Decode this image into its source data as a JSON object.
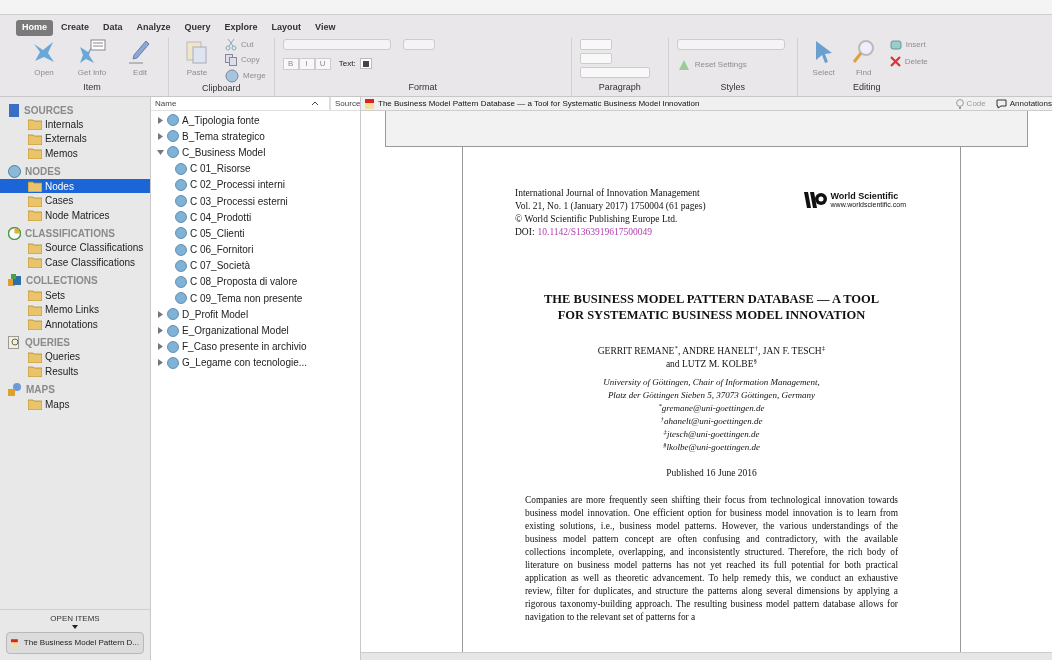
{
  "ribbon": {
    "tabs": [
      {
        "label": "Home",
        "selected": true
      },
      {
        "label": "Create",
        "selected": false
      },
      {
        "label": "Data",
        "selected": false
      },
      {
        "label": "Analyze",
        "selected": false
      },
      {
        "label": "Query",
        "selected": false
      },
      {
        "label": "Explore",
        "selected": false
      },
      {
        "label": "Layout",
        "selected": false
      },
      {
        "label": "View",
        "selected": false
      }
    ],
    "groups": [
      {
        "label": "Item",
        "tools": [
          {
            "kind": "open",
            "label": "Open",
            "disabled": true
          },
          {
            "kind": "info",
            "label": "Get Info",
            "disabled": true
          },
          {
            "kind": "edit",
            "label": "Edit",
            "disabled": true
          }
        ]
      },
      {
        "label": "Clipboard",
        "tools": [
          {
            "kind": "paste",
            "label": "Paste",
            "disabled": true
          },
          {
            "kind": "cut",
            "label": "Cut",
            "disabled": true
          },
          {
            "kind": "copy",
            "label": "Copy",
            "disabled": true
          },
          {
            "kind": "merge",
            "label": "Merge",
            "disabled": true
          }
        ]
      },
      {
        "label": "Format",
        "tools": [
          {
            "kind": "b",
            "label": "B",
            "disabled": true
          },
          {
            "kind": "i",
            "label": "I",
            "disabled": true
          },
          {
            "kind": "u",
            "label": "U",
            "disabled": true
          },
          {
            "kind": "text",
            "label": "Text:",
            "disabled": false
          }
        ]
      },
      {
        "label": "Paragraph"
      },
      {
        "label": "Styles",
        "tools": [
          {
            "kind": "reset",
            "label": "Reset Settings",
            "disabled": true
          }
        ]
      },
      {
        "label": "Editing",
        "tools": [
          {
            "kind": "select",
            "label": "Select",
            "disabled": true
          },
          {
            "kind": "find",
            "label": "Find",
            "disabled": true
          },
          {
            "kind": "insert",
            "label": "Insert",
            "disabled": true
          },
          {
            "kind": "delete",
            "label": "Delete",
            "disabled": true
          }
        ]
      }
    ]
  },
  "sidebar": {
    "sections": [
      {
        "kind": "sources",
        "title": "SOURCES",
        "items": [
          {
            "label": "Internals",
            "selected": false
          },
          {
            "label": "Externals",
            "selected": false
          },
          {
            "label": "Memos",
            "selected": false
          }
        ]
      },
      {
        "kind": "nodes",
        "title": "NODES",
        "items": [
          {
            "label": "Nodes",
            "selected": true
          },
          {
            "label": "Cases",
            "selected": false
          },
          {
            "label": "Node Matrices",
            "selected": false
          }
        ]
      },
      {
        "kind": "classifications",
        "title": "CLASSIFICATIONS",
        "items": [
          {
            "label": "Source Classifications",
            "selected": false
          },
          {
            "label": "Case Classifications",
            "selected": false
          }
        ]
      },
      {
        "kind": "collections",
        "title": "COLLECTIONS",
        "items": [
          {
            "label": "Sets",
            "selected": false
          },
          {
            "label": "Memo Links",
            "selected": false
          },
          {
            "label": "Annotations",
            "selected": false
          }
        ]
      },
      {
        "kind": "queries",
        "title": "QUERIES",
        "items": [
          {
            "label": "Queries",
            "selected": false
          },
          {
            "label": "Results",
            "selected": false
          }
        ]
      },
      {
        "kind": "maps",
        "title": "MAPS",
        "items": [
          {
            "label": "Maps",
            "selected": false
          }
        ]
      }
    ],
    "open_items_label": "OPEN ITEMS",
    "open_items": [
      "The Business Model Pattern D..."
    ]
  },
  "node_list": {
    "columns": [
      "Name",
      "Source"
    ],
    "rows": [
      {
        "name": "A_Tipologia fonte",
        "expanded": false
      },
      {
        "name": "B_Tema strategico",
        "expanded": false
      },
      {
        "name": "C_Business Model",
        "expanded": true,
        "children": [
          {
            "name": "C 01_Risorse"
          },
          {
            "name": "C 02_Processi interni"
          },
          {
            "name": "C 03_Processi esterni"
          },
          {
            "name": "C 04_Prodotti"
          },
          {
            "name": "C 05_Clienti"
          },
          {
            "name": "C 06_Fornitori"
          },
          {
            "name": "C 07_Società"
          },
          {
            "name": "C 08_Proposta di valore"
          },
          {
            "name": "C 09_Tema non presente"
          }
        ]
      },
      {
        "name": "D_Profit Model",
        "expanded": false
      },
      {
        "name": "E_Organizational Model",
        "expanded": false
      },
      {
        "name": "F_Caso presente in archivio",
        "expanded": false
      },
      {
        "name": "G_Legame con tecnologie...",
        "expanded": false
      }
    ]
  },
  "document": {
    "tab_title": "The Business Model Pattern Database — a Tool for Systematic Business Model Innovation",
    "actions": [
      {
        "kind": "code",
        "label": "Code",
        "disabled": true
      },
      {
        "kind": "annotations",
        "label": "Annotations",
        "disabled": false
      }
    ],
    "journal_lines": [
      "International Journal of Innovation Management",
      "Vol. 21, No. 1 (January 2017) 1750004 (61 pages)",
      "© World Scientific Publishing Europe Ltd."
    ],
    "doi_label": "DOI:",
    "doi": "10.1142/S1363919617500049",
    "publisher_name": "World Scientific",
    "publisher_url": "www.worldscientific.com",
    "title_lines": [
      "THE BUSINESS MODEL PATTERN DATABASE — A TOOL",
      "FOR SYSTEMATIC BUSINESS MODEL INNOVATION"
    ],
    "author_lines": [
      "GERRIT REMANE$^{*}$, ANDRE HANELT$^{†}$, JAN F. TESCH$^{‡}$",
      "and LUTZ M. KOLBE$^{§}$"
    ],
    "affiliation_lines": [
      "University of Göttingen, Chair of Information Management,",
      "Platz der Göttingen Sieben 5, 37073 Göttingen, Germany",
      "$^{*}$gremane@uni-goettingen.de",
      "$^{†}$ahanelt@uni-goettingen.de",
      "$^{‡}$jtesch@uni-goettingen.de",
      "$^{§}$lkolbe@uni-goettingen.de"
    ],
    "published": "Published 16 June 2016",
    "abstract": "Companies are more frequently seen shifting their focus from technological innovation towards business model innovation. One efficient option for business model innovation is to learn from existing solutions, i.e., business model patterns. However, the various understandings of the business model pattern concept are often confusing and contradictory, with the available collections incomplete, overlapping, and inconsistently structured. Therefore, the rich body of literature on business model patterns has not yet reached its full potential for both practical application as well as theoretic advancement. To help remedy this, we conduct an exhaustive review, filter for duplicates, and structure the patterns along several dimensions by applying a rigorous taxonomy-building approach. The resulting business model pattern database allows for navigation to the relevant set of patterns for a"
  }
}
